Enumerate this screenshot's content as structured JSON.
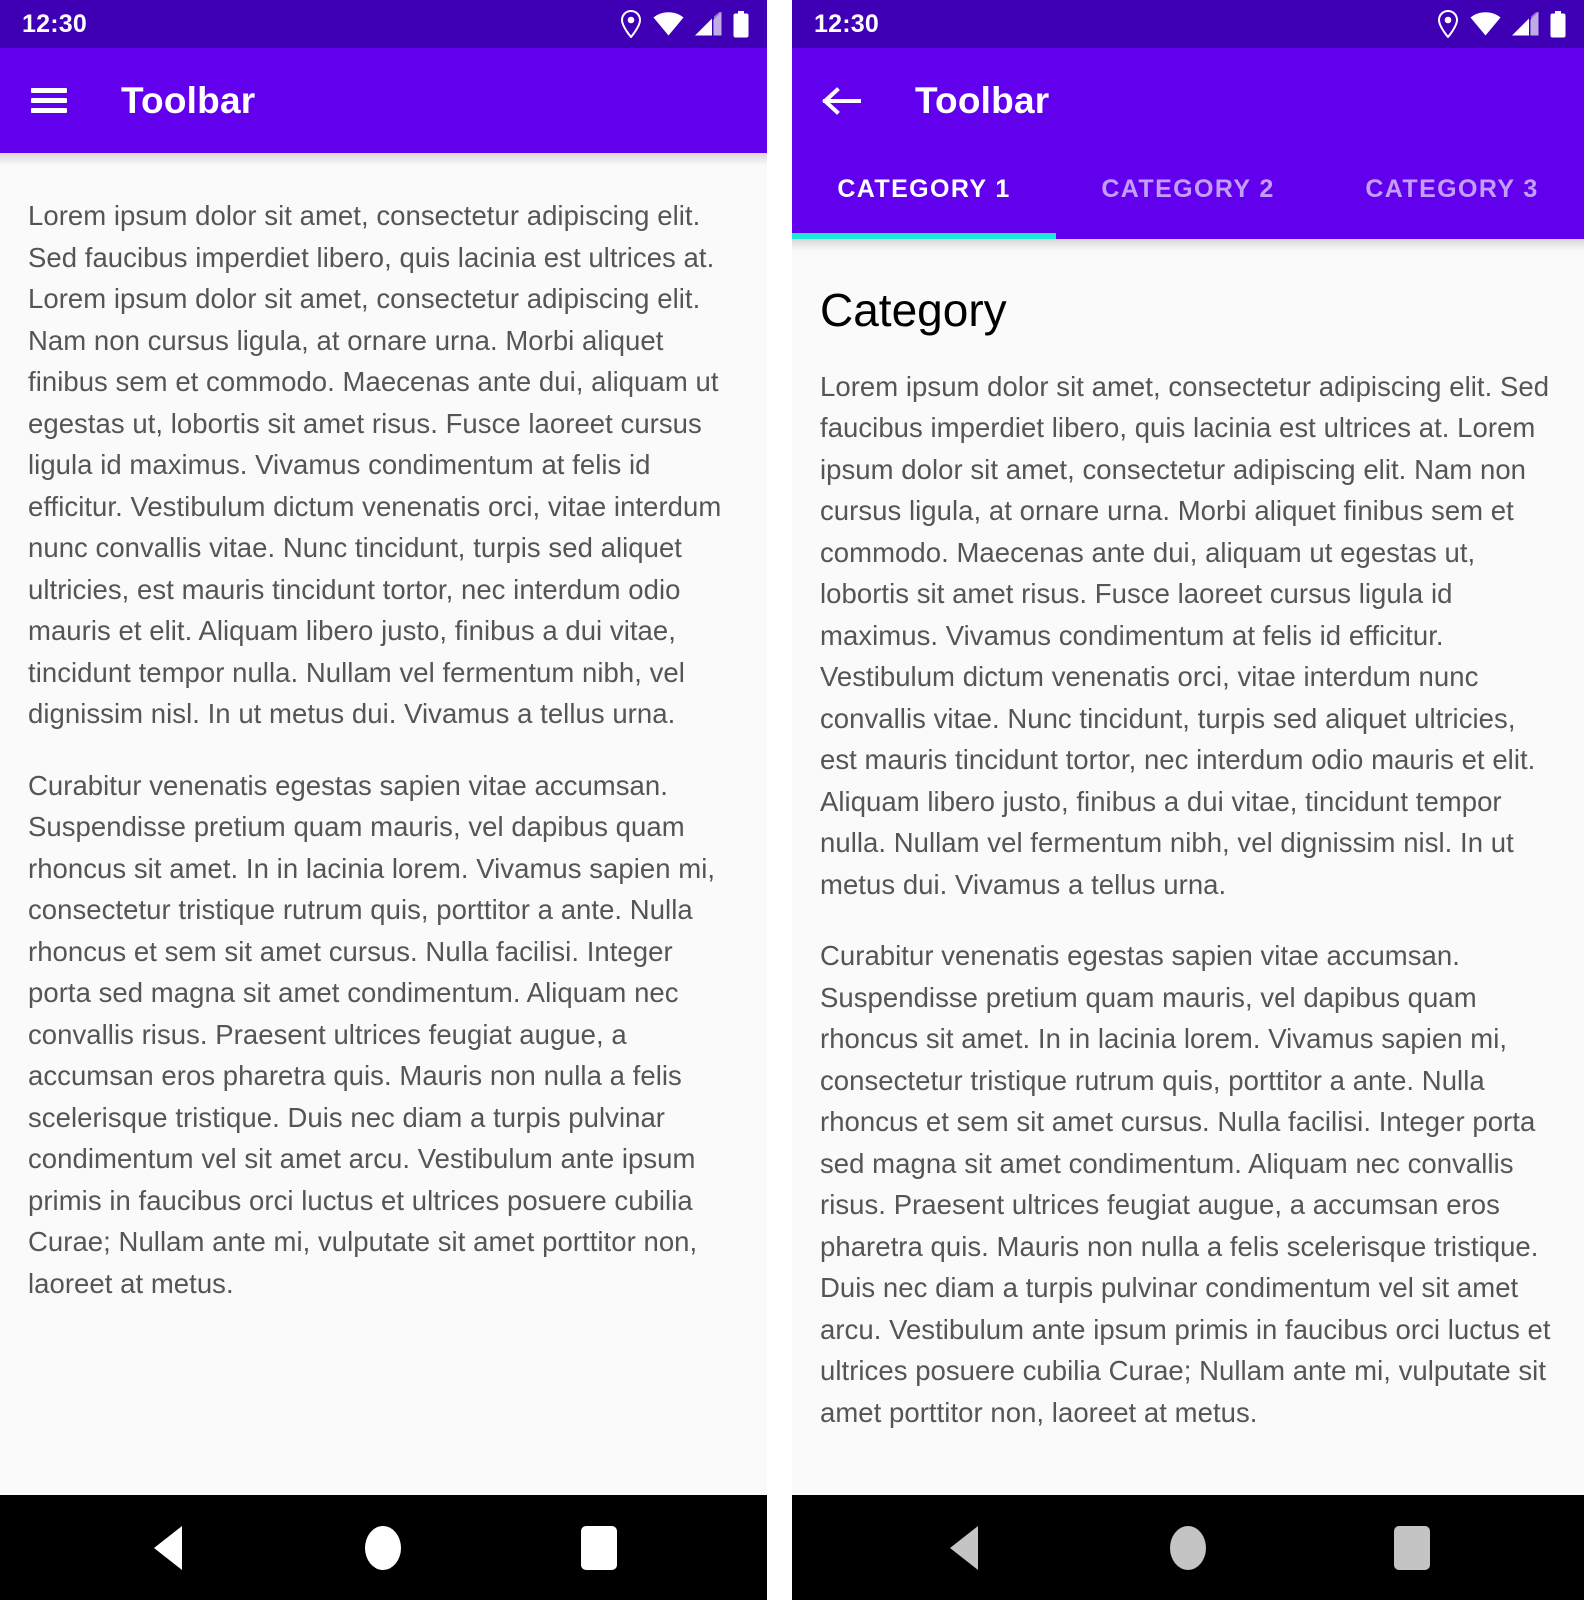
{
  "colors": {
    "status_bar": "#3F00B5",
    "toolbar": "#6200EE",
    "tab_indicator": "#1DE9D6",
    "content_bg": "#FAFAFA",
    "body_text": "#555555",
    "nav_bar": "#000000"
  },
  "status_bar": {
    "time": "12:30",
    "icons": [
      "location-pin-icon",
      "wifi-icon",
      "cellular-signal-icon",
      "battery-icon"
    ]
  },
  "left_screen": {
    "toolbar": {
      "menu_icon": "hamburger-menu-icon",
      "title": "Toolbar"
    },
    "content": {
      "paragraphs": [
        "Lorem ipsum dolor sit amet, consectetur adipiscing elit. Sed faucibus imperdiet libero, quis lacinia est ultrices at. Lorem ipsum dolor sit amet, consectetur adipiscing elit. Nam non cursus ligula, at ornare urna. Morbi aliquet finibus sem et commodo. Maecenas ante dui, aliquam ut egestas ut, lobortis sit amet risus. Fusce laoreet cursus ligula id maximus. Vivamus condimentum at felis id efficitur. Vestibulum dictum venenatis orci, vitae interdum nunc convallis vitae. Nunc tincidunt, turpis sed aliquet ultricies, est mauris tincidunt tortor, nec interdum odio mauris et elit. Aliquam libero justo, finibus a dui vitae, tincidunt tempor nulla. Nullam vel fermentum nibh, vel dignissim nisl. In ut metus dui. Vivamus a tellus urna.",
        "Curabitur venenatis egestas sapien vitae accumsan. Suspendisse pretium quam mauris, vel dapibus quam rhoncus sit amet. In in lacinia lorem. Vivamus sapien mi, consectetur tristique rutrum quis, porttitor a ante. Nulla rhoncus et sem sit amet cursus. Nulla facilisi. Integer porta sed magna sit amet condimentum. Aliquam nec convallis risus. Praesent ultrices feugiat augue, a accumsan eros pharetra quis. Mauris non nulla a felis scelerisque tristique. Duis nec diam a turpis pulvinar condimentum vel sit amet arcu. Vestibulum ante ipsum primis in faucibus orci luctus et ultrices posuere cubilia Curae; Nullam ante mi, vulputate sit amet porttitor non, laoreet at metus."
      ]
    },
    "navigation_bar": {
      "back_label": "back-button",
      "home_label": "home-button",
      "recents_label": "recents-button"
    }
  },
  "right_screen": {
    "toolbar": {
      "back_icon": "back-arrow-icon",
      "title": "Toolbar"
    },
    "tabs": [
      {
        "label": "CATEGORY 1",
        "active": true
      },
      {
        "label": "CATEGORY 2",
        "active": false
      },
      {
        "label": "CATEGORY 3",
        "active": false
      }
    ],
    "content": {
      "heading": "Category",
      "paragraphs": [
        "Lorem ipsum dolor sit amet, consectetur adipiscing elit. Sed faucibus imperdiet libero, quis lacinia est ultrices at. Lorem ipsum dolor sit amet, consectetur adipiscing elit. Nam non cursus ligula, at ornare urna. Morbi aliquet finibus sem et commodo. Maecenas ante dui, aliquam ut egestas ut, lobortis sit amet risus. Fusce laoreet cursus ligula id maximus. Vivamus condimentum at felis id efficitur. Vestibulum dictum venenatis orci, vitae interdum nunc convallis vitae. Nunc tincidunt, turpis sed aliquet ultricies, est mauris tincidunt tortor, nec interdum odio mauris et elit. Aliquam libero justo, finibus a dui vitae, tincidunt tempor nulla. Nullam vel fermentum nibh, vel dignissim nisl. In ut metus dui. Vivamus a tellus urna.",
        "Curabitur venenatis egestas sapien vitae accumsan. Suspendisse pretium quam mauris, vel dapibus quam rhoncus sit amet. In in lacinia lorem. Vivamus sapien mi, consectetur tristique rutrum quis, porttitor a ante. Nulla rhoncus et sem sit amet cursus. Nulla facilisi. Integer porta sed magna sit amet condimentum. Aliquam nec convallis risus. Praesent ultrices feugiat augue, a accumsan eros pharetra quis. Mauris non nulla a felis scelerisque tristique. Duis nec diam a turpis pulvinar condimentum vel sit amet arcu. Vestibulum ante ipsum primis in faucibus orci luctus et ultrices posuere cubilia Curae; Nullam ante mi, vulputate sit amet porttitor non, laoreet at metus."
      ]
    },
    "navigation_bar": {
      "back_label": "back-button",
      "home_label": "home-button",
      "recents_label": "recents-button"
    }
  }
}
